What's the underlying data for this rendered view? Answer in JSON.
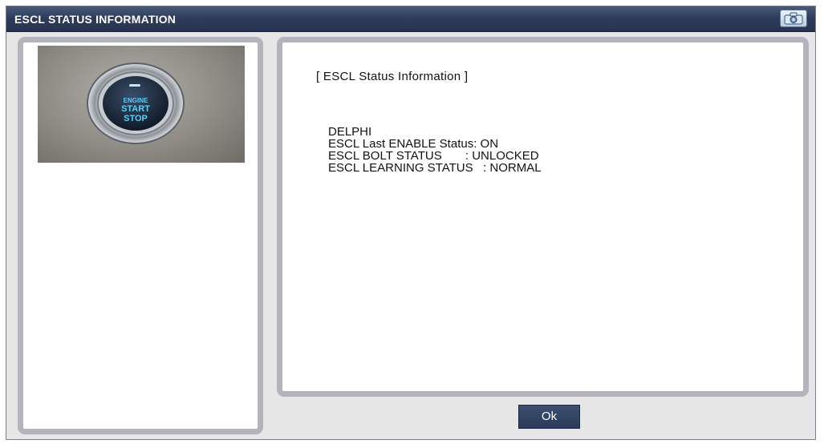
{
  "window": {
    "title": "ESCL STATUS INFORMATION",
    "title_icon": "camera-icon",
    "title_bar_color": "#2f3d5c"
  },
  "left_panel": {
    "image": {
      "subject": "start-stop-button-photo",
      "button_text": [
        "ENGINE",
        "START",
        "STOP"
      ],
      "glow_color": "#4fd2ff"
    }
  },
  "right_panel": {
    "section_title": "[ ESCL Status Information ]",
    "lines": [
      "DELPHI",
      "ESCL Last ENABLE Status: ON",
      "ESCL BOLT STATUS       : UNLOCKED",
      "ESCL LEARNING STATUS   : NORMAL"
    ]
  },
  "footer": {
    "ok_label": "Ok"
  }
}
